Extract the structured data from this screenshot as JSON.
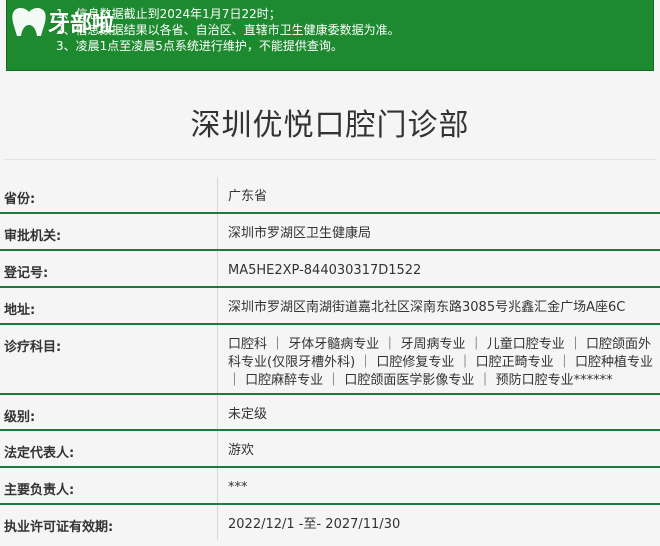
{
  "notice": {
    "lines": [
      "1、信息数据截止到2024年1月7日22时；",
      "2、信息数据结果以各省、自治区、直辖市卫生健康委数据为准。",
      "3、凌晨1点至凌晨5点系统进行维护，不能提供查询。"
    ]
  },
  "logo": {
    "text": "牙部啦"
  },
  "page": {
    "title": "深圳优悦口腔门诊部"
  },
  "rows": [
    {
      "label": "省份:",
      "value": "广东省"
    },
    {
      "label": "审批机关:",
      "value": "深圳市罗湖区卫生健康局"
    },
    {
      "label": "登记号:",
      "value": "MA5HE2XP-844030317D1522"
    },
    {
      "label": "地址:",
      "value": "深圳市罗湖区南湖街道嘉北社区深南东路3085号兆鑫汇金广场A座6C"
    },
    {
      "label": "诊疗科目:",
      "value": "口腔科 ｜ 牙体牙髓病专业 ｜ 牙周病专业 ｜ 儿童口腔专业 ｜ 口腔颌面外科专业(仅限牙槽外科) ｜ 口腔修复专业 ｜ 口腔正畸专业 ｜ 口腔种植专业 ｜ 口腔麻醉专业 ｜ 口腔颌面医学影像专业 ｜ 预防口腔专业******"
    },
    {
      "label": "级别:",
      "value": "未定级"
    },
    {
      "label": "法定代表人:",
      "value": "游欢"
    },
    {
      "label": "主要负责人:",
      "value": "***"
    },
    {
      "label": "执业许可证有效期:",
      "value": "2022/12/1 -至- 2027/11/30"
    }
  ]
}
